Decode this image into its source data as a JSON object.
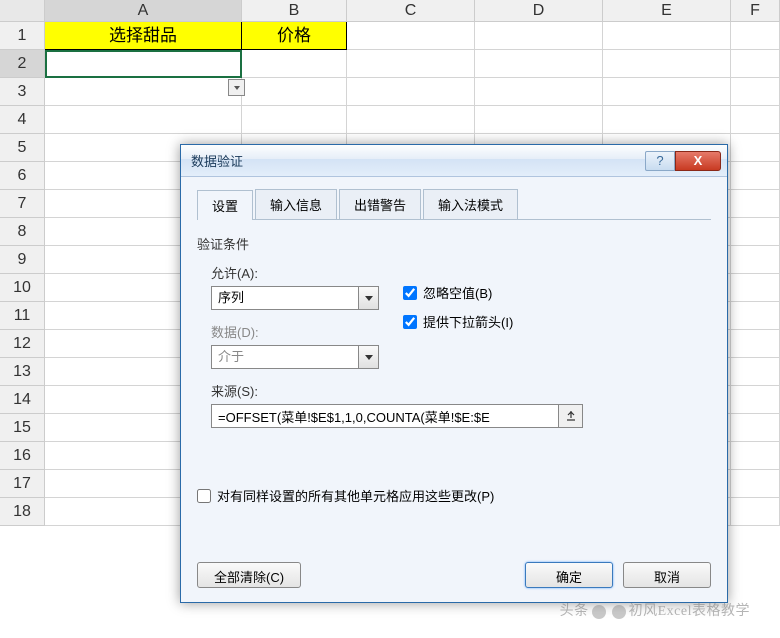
{
  "columns": [
    "A",
    "B",
    "C",
    "D",
    "E",
    "F"
  ],
  "rows": [
    "1",
    "2",
    "3",
    "4",
    "5",
    "6",
    "7",
    "8",
    "9",
    "10",
    "11",
    "12",
    "13",
    "14",
    "15",
    "16",
    "17",
    "18"
  ],
  "sheet": {
    "a1": "选择甜品",
    "b1": "价格"
  },
  "dialog": {
    "title": "数据验证",
    "help": "?",
    "close": "X",
    "tabs": [
      "设置",
      "输入信息",
      "出错警告",
      "输入法模式"
    ],
    "criteria_label": "验证条件",
    "allow_label": "允许(A):",
    "allow_value": "序列",
    "ignore_blank": "忽略空值(B)",
    "dropdown_incell": "提供下拉箭头(I)",
    "data_label": "数据(D):",
    "data_value": "介于",
    "source_label": "来源(S):",
    "source_value": "=OFFSET(菜单!$E$1,1,0,COUNTA(菜单!$E:$E",
    "apply_others": "对有同样设置的所有其他单元格应用这些更改(P)",
    "clear_all": "全部清除(C)",
    "ok": "确定",
    "cancel": "取消"
  },
  "watermark": {
    "prefix": "头条",
    "text": "初风Excel表格教学"
  }
}
